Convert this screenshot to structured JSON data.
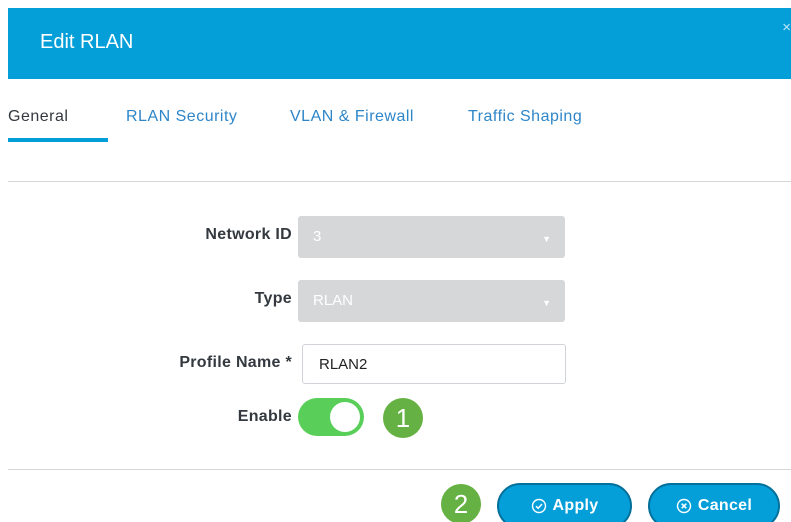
{
  "dialog": {
    "title": "Edit RLAN",
    "close_glyph": "×"
  },
  "tabs": [
    {
      "label": "General",
      "active": true
    },
    {
      "label": "RLAN Security",
      "active": false
    },
    {
      "label": "VLAN & Firewall",
      "active": false
    },
    {
      "label": "Traffic Shaping",
      "active": false
    }
  ],
  "form": {
    "network_id": {
      "label": "Network ID",
      "value": "3",
      "disabled": true
    },
    "type": {
      "label": "Type",
      "value": "RLAN",
      "disabled": true
    },
    "profile_name": {
      "label": "Profile Name *",
      "value": "RLAN2"
    },
    "enable": {
      "label": "Enable",
      "on": true
    }
  },
  "callouts": {
    "one": "1",
    "two": "2"
  },
  "buttons": {
    "apply": {
      "label": "Apply",
      "icon": "check-circle-icon"
    },
    "cancel": {
      "label": "Cancel",
      "icon": "x-circle-icon"
    }
  },
  "colors": {
    "header": "#049fd9",
    "tab_active_underline": "#049fd9",
    "toggle_on": "#59cf5a",
    "callout": "#66b143",
    "button": "#049fd9"
  }
}
